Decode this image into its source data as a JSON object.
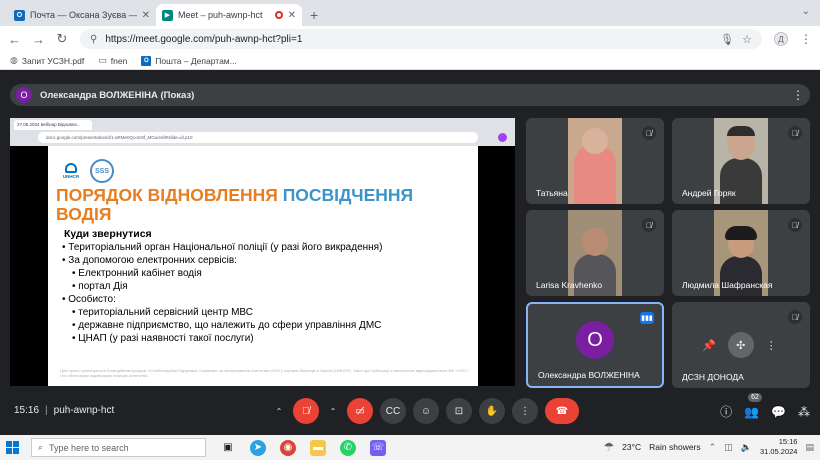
{
  "browser": {
    "tabs": [
      {
        "title": "Почта — Оксана Зуєва — Outl",
        "icon": "outlook-icon",
        "color": "#0f6cbd",
        "glyph": "O"
      },
      {
        "title": "Meet – puh-awnp-hct",
        "icon": "meet-icon",
        "color": "#00897b",
        "glyph": "▶"
      }
    ],
    "url": "https://meet.google.com/puh-awnp-hct?pli=1",
    "profile_initial": "Д",
    "bookmarks": [
      {
        "label": "Запит УСЗН.pdf",
        "icon": "globe-icon"
      },
      {
        "label": "fnen",
        "icon": "folder-icon"
      },
      {
        "label": "Пошта – Департам...",
        "icon": "outlook-icon"
      }
    ]
  },
  "meet": {
    "presenter": {
      "initial": "О",
      "label": "Олександра ВОЛЖЕНІНА (Показ)"
    },
    "shared_screen": {
      "tab_title": "27.05.2024 вебінар Відновле...",
      "url": "docs.google.com/presentation/d/1-aRMe0QcoIc9f_MGu/edit#slide=id.p10"
    },
    "slide": {
      "unhcr_label": "UNHCR",
      "sss_label": "SSS",
      "title_orange": "ПОРЯДОК ВІДНОВЛЕННЯ ",
      "title_blue": "ПОСВІДЧЕННЯ",
      "title_line2": "ВОДІЯ",
      "subtitle": "Куди звернутися",
      "items": [
        {
          "level": 1,
          "text": "• Територіальний орган Національної поліції (у разі його викрадення)"
        },
        {
          "level": 1,
          "text": "• За допомогою електронних сервісів:"
        },
        {
          "level": 2,
          "text": "• Електронний кабінет водія"
        },
        {
          "level": 2,
          "text": "• портал Дія"
        },
        {
          "level": 1,
          "text": "• Особисто:"
        },
        {
          "level": 2,
          "text": "• територіальний сервісний центр МВС"
        },
        {
          "level": 2,
          "text": "• державне підприємство, що належить до сфери управління ДМС"
        },
        {
          "level": 2,
          "text": "• ЦНАП (у разі наявності такої послуги)"
        }
      ],
      "footnote": "Цей проект реалізується Благодійним фондом «Стабілізаційна Підтримка Сервісам» за фінансування Агентства ООН у справах біженців в Україні (UNHCR). Зміст цієї публікації є виключною відповідальністю БФ «СПС» і не обов'язково відображає позицію Агентства."
    },
    "participants": [
      {
        "name": "Татьяна",
        "type": "video",
        "muted": true,
        "bg": "#c9a98d",
        "person": "#e98a82"
      },
      {
        "name": "Андрей Горяк",
        "type": "video",
        "muted": true,
        "bg": "#b8b4a8",
        "person": "#3a3a3a"
      },
      {
        "name": "Larisa Kravhenko",
        "type": "video",
        "muted": true,
        "bg": "#a08e76",
        "person": "#55555a"
      },
      {
        "name": "Людмила Шафранская",
        "type": "video",
        "muted": true,
        "bg": "#a8967a",
        "person": "#2a2a30"
      },
      {
        "name": "Олександра ВОЛЖЕНІНА",
        "type": "avatar",
        "initial": "О",
        "speaking": true
      },
      {
        "name": "ДСЗН ДОНОДА",
        "type": "avatar",
        "muted": true
      }
    ],
    "meeting_time": "15:16",
    "meeting_code": "puh-awnp-hct",
    "participant_count": "62"
  },
  "taskbar": {
    "search_placeholder": "Type here to search",
    "temperature": "23°C",
    "weather": "Rain showers",
    "time": "15:16",
    "date": "31.05.2024"
  }
}
